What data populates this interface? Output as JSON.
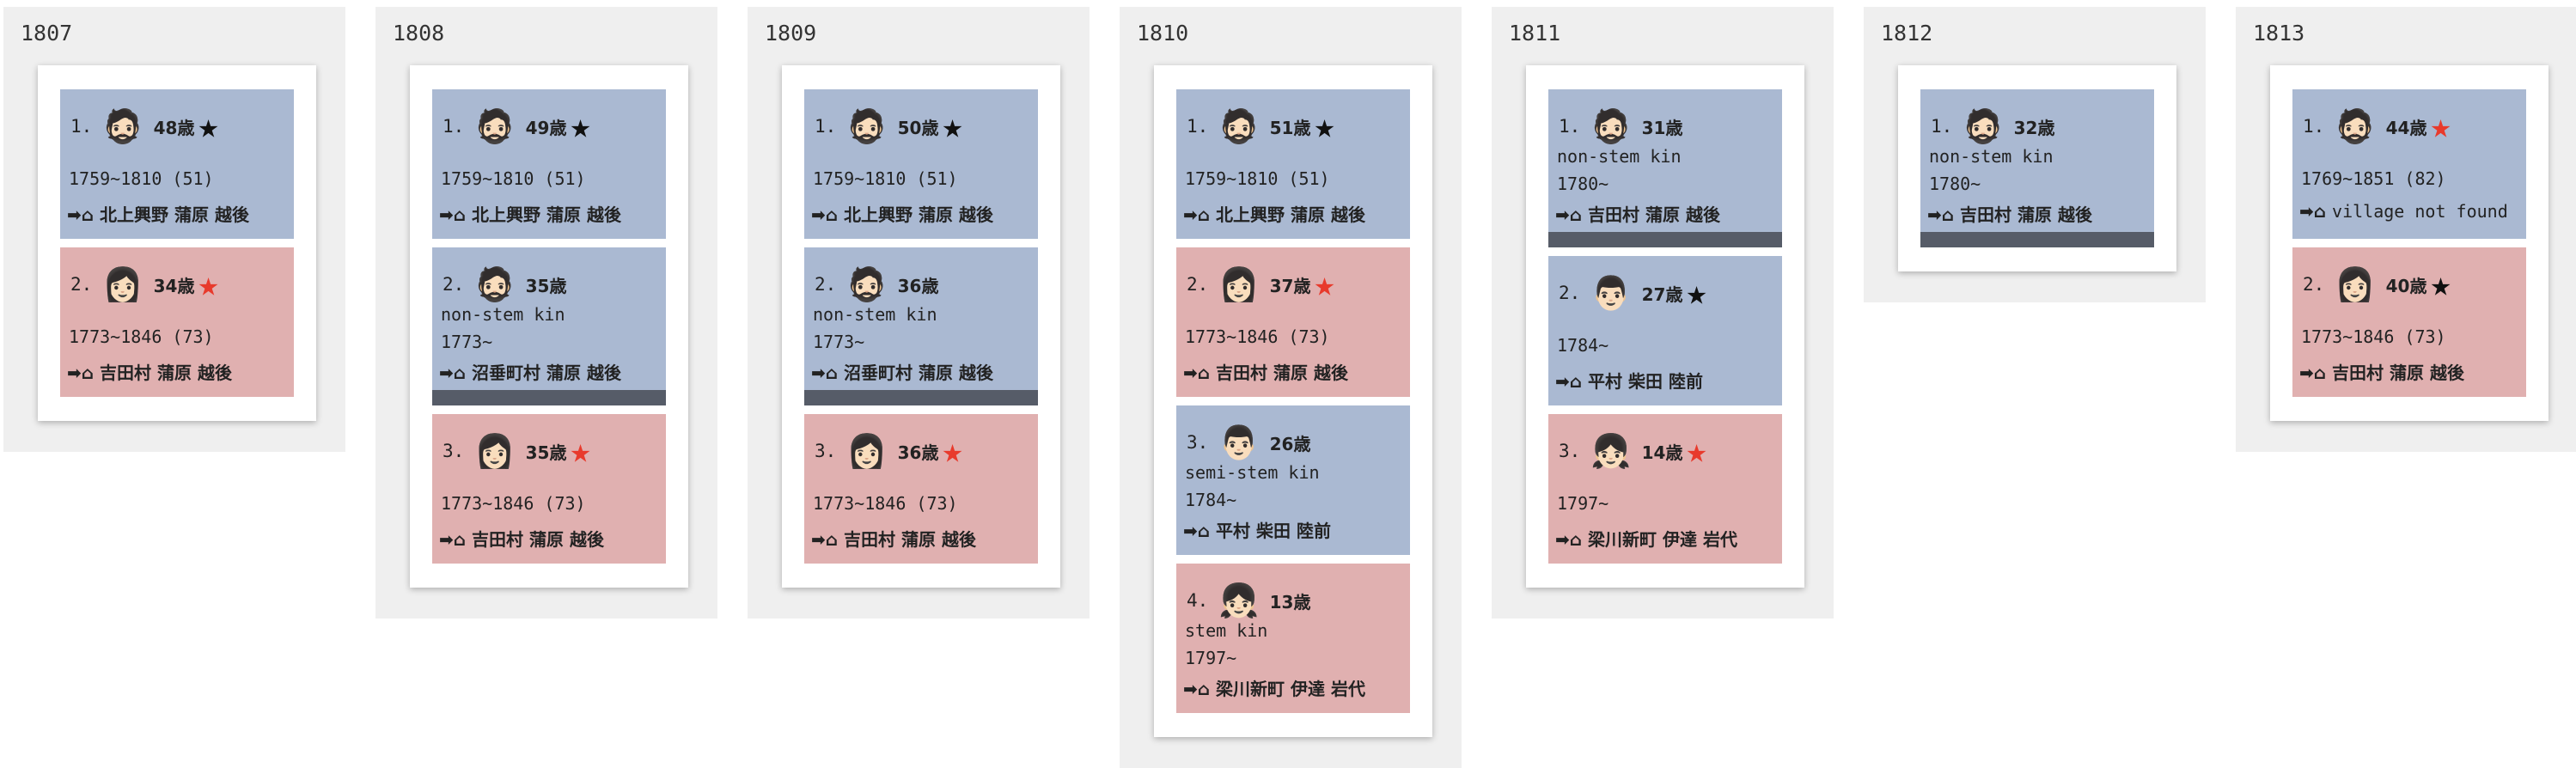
{
  "columns": [
    {
      "year": "1807",
      "entries": [
        {
          "num": "1.",
          "gender": "male",
          "face": "🧔🏻",
          "age": "48歳",
          "star": "black",
          "kin": "",
          "dates": "1759~1810 (51)",
          "location": "北上興野 蒲原 越後",
          "ended": false
        },
        {
          "num": "2.",
          "gender": "female",
          "face": "👩🏻",
          "age": "34歳",
          "star": "red",
          "kin": "",
          "dates": "1773~1846 (73)",
          "location": "吉田村 蒲原 越後",
          "ended": false
        }
      ]
    },
    {
      "year": "1808",
      "entries": [
        {
          "num": "1.",
          "gender": "male",
          "face": "🧔🏻",
          "age": "49歳",
          "star": "black",
          "kin": "",
          "dates": "1759~1810 (51)",
          "location": "北上興野 蒲原 越後",
          "ended": false
        },
        {
          "num": "2.",
          "gender": "male",
          "face": "🧔🏻",
          "age": "35歳",
          "star": "",
          "kin": "non-stem kin",
          "dates": "1773~",
          "location": "沼垂町村 蒲原 越後",
          "ended": true
        },
        {
          "num": "3.",
          "gender": "female",
          "face": "👩🏻",
          "age": "35歳",
          "star": "red",
          "kin": "",
          "dates": "1773~1846 (73)",
          "location": "吉田村 蒲原 越後",
          "ended": false
        }
      ]
    },
    {
      "year": "1809",
      "entries": [
        {
          "num": "1.",
          "gender": "male",
          "face": "🧔🏻",
          "age": "50歳",
          "star": "black",
          "kin": "",
          "dates": "1759~1810 (51)",
          "location": "北上興野 蒲原 越後",
          "ended": false
        },
        {
          "num": "2.",
          "gender": "male",
          "face": "🧔🏻",
          "age": "36歳",
          "star": "",
          "kin": "non-stem kin",
          "dates": "1773~",
          "location": "沼垂町村 蒲原 越後",
          "ended": true
        },
        {
          "num": "3.",
          "gender": "female",
          "face": "👩🏻",
          "age": "36歳",
          "star": "red",
          "kin": "",
          "dates": "1773~1846 (73)",
          "location": "吉田村 蒲原 越後",
          "ended": false
        }
      ]
    },
    {
      "year": "1810",
      "entries": [
        {
          "num": "1.",
          "gender": "male",
          "face": "🧔🏻",
          "age": "51歳",
          "star": "black",
          "kin": "",
          "dates": "1759~1810 (51)",
          "location": "北上興野 蒲原 越後",
          "ended": false
        },
        {
          "num": "2.",
          "gender": "female",
          "face": "👩🏻",
          "age": "37歳",
          "star": "red",
          "kin": "",
          "dates": "1773~1846 (73)",
          "location": "吉田村 蒲原 越後",
          "ended": false
        },
        {
          "num": "3.",
          "gender": "male",
          "face": "👨🏻",
          "age": "26歳",
          "star": "",
          "kin": "semi-stem kin",
          "dates": "1784~",
          "location": "平村 柴田 陸前",
          "ended": false
        },
        {
          "num": "4.",
          "gender": "female",
          "face": "👧🏻",
          "age": "13歳",
          "star": "",
          "kin": "stem kin",
          "dates": "1797~",
          "location": "梁川新町 伊達 岩代",
          "ended": false
        }
      ]
    },
    {
      "year": "1811",
      "entries": [
        {
          "num": "1.",
          "gender": "male",
          "face": "🧔🏻",
          "age": "31歳",
          "star": "",
          "kin": "non-stem kin",
          "dates": "1780~",
          "location": "吉田村 蒲原 越後",
          "ended": true
        },
        {
          "num": "2.",
          "gender": "male",
          "face": "👨🏻",
          "age": "27歳",
          "star": "black",
          "kin": "",
          "dates": "1784~",
          "location": "平村 柴田 陸前",
          "ended": false
        },
        {
          "num": "3.",
          "gender": "female",
          "face": "👧🏻",
          "age": "14歳",
          "star": "red",
          "kin": "",
          "dates": "1797~",
          "location": "梁川新町 伊達 岩代",
          "ended": false
        }
      ]
    },
    {
      "year": "1812",
      "entries": [
        {
          "num": "1.",
          "gender": "male",
          "face": "🧔🏻",
          "age": "32歳",
          "star": "",
          "kin": "non-stem kin",
          "dates": "1780~",
          "location": "吉田村 蒲原 越後",
          "ended": true
        }
      ]
    },
    {
      "year": "1813",
      "entries": [
        {
          "num": "1.",
          "gender": "male",
          "face": "🧔🏻",
          "age": "44歳",
          "star": "red",
          "kin": "",
          "dates": "1769~1851 (82)",
          "location": "village not found",
          "ended": false
        },
        {
          "num": "2.",
          "gender": "female",
          "face": "👩🏻",
          "age": "40歳",
          "star": "black",
          "kin": "",
          "dates": "1773~1846 (73)",
          "location": "吉田村 蒲原 越後",
          "ended": false
        }
      ]
    }
  ],
  "symbols": {
    "star": "★",
    "location_prefix": "➡⌂"
  },
  "colors": {
    "male": "#aab9d2",
    "female": "#e0b0b0",
    "ended_bar": "#565c68",
    "star_red": "#e83a2c",
    "star_black": "#111111"
  }
}
